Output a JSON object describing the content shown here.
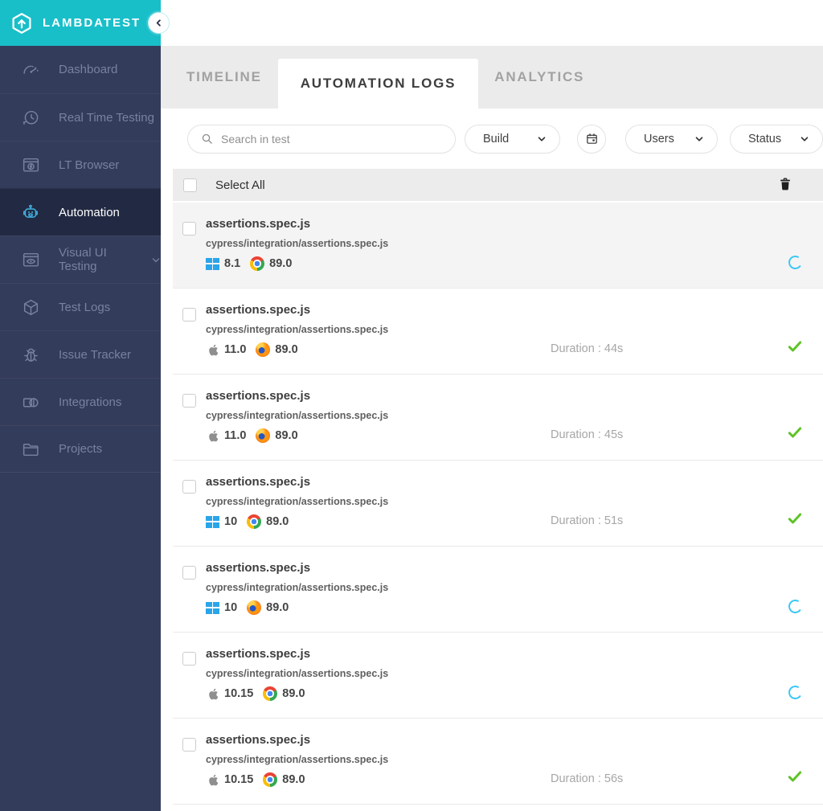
{
  "brand": {
    "name": "LAMBDATEST",
    "color": "#18bfc9"
  },
  "sidebar": {
    "items": [
      {
        "label": "Dashboard",
        "icon": "gauge-icon",
        "active": false
      },
      {
        "label": "Real Time Testing",
        "icon": "realtime-clock-icon",
        "active": false
      },
      {
        "label": "LT Browser",
        "icon": "lt-browser-icon",
        "active": false
      },
      {
        "label": "Automation",
        "icon": "robot-icon",
        "active": true
      },
      {
        "label": "Visual UI Testing",
        "icon": "visual-ui-icon",
        "active": false,
        "has_chevron": true
      },
      {
        "label": "Test Logs",
        "icon": "cube-icon",
        "active": false
      },
      {
        "label": "Issue Tracker",
        "icon": "bug-icon",
        "active": false
      },
      {
        "label": "Integrations",
        "icon": "integrations-icon",
        "active": false
      },
      {
        "label": "Projects",
        "icon": "folder-icon",
        "active": false
      }
    ]
  },
  "tabs": [
    {
      "label": "TIMELINE",
      "active": false
    },
    {
      "label": "AUTOMATION LOGS",
      "active": true
    },
    {
      "label": "ANALYTICS",
      "active": false
    }
  ],
  "filters": {
    "search_placeholder": "Search in test",
    "build_label": "Build",
    "users_label": "Users",
    "status_label": "Status"
  },
  "list_header": {
    "select_all_label": "Select All"
  },
  "rows": [
    {
      "title": "assertions.spec.js",
      "path": "cypress/integration/assertions.spec.js",
      "os": "windows",
      "os_version": "8.1",
      "browser": "chrome",
      "browser_version": "89.0",
      "duration": "",
      "status": "running"
    },
    {
      "title": "assertions.spec.js",
      "path": "cypress/integration/assertions.spec.js",
      "os": "mac",
      "os_version": "11.0",
      "browser": "firefox",
      "browser_version": "89.0",
      "duration": "Duration : 44s",
      "status": "passed"
    },
    {
      "title": "assertions.spec.js",
      "path": "cypress/integration/assertions.spec.js",
      "os": "mac",
      "os_version": "11.0",
      "browser": "firefox",
      "browser_version": "89.0",
      "duration": "Duration : 45s",
      "status": "passed"
    },
    {
      "title": "assertions.spec.js",
      "path": "cypress/integration/assertions.spec.js",
      "os": "windows",
      "os_version": "10",
      "browser": "chrome",
      "browser_version": "89.0",
      "duration": "Duration : 51s",
      "status": "passed"
    },
    {
      "title": "assertions.spec.js",
      "path": "cypress/integration/assertions.spec.js",
      "os": "windows",
      "os_version": "10",
      "browser": "firefox",
      "browser_version": "89.0",
      "duration": "",
      "status": "running"
    },
    {
      "title": "assertions.spec.js",
      "path": "cypress/integration/assertions.spec.js",
      "os": "mac",
      "os_version": "10.15",
      "browser": "chrome",
      "browser_version": "89.0",
      "duration": "",
      "status": "running"
    },
    {
      "title": "assertions.spec.js",
      "path": "cypress/integration/assertions.spec.js",
      "os": "mac",
      "os_version": "10.15",
      "browser": "chrome",
      "browser_version": "89.0",
      "duration": "Duration : 56s",
      "status": "passed"
    }
  ],
  "status_colors": {
    "running": "#38c8f5",
    "passed": "#5ec327"
  }
}
